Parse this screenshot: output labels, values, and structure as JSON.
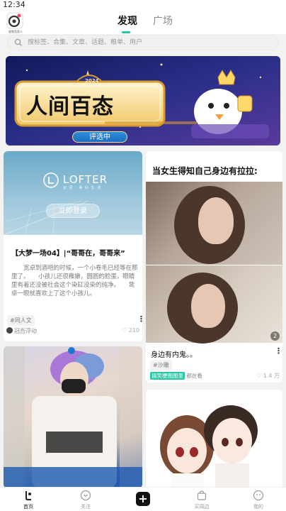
{
  "status": {
    "time": "12:34"
  },
  "header": {
    "logo_caption": "放牧吾家人",
    "tabs": [
      {
        "label": "发现",
        "active": true
      },
      {
        "label": "广场",
        "active": false
      }
    ]
  },
  "search": {
    "placeholder": "搜标签、合集、文章、话题、粮单、用户"
  },
  "banner": {
    "title": "人间百态",
    "year": "2024",
    "button": "评选中"
  },
  "feed": {
    "left": [
      {
        "brand": "LOFTER",
        "brand_tagline": "记 录 · 美 好 生 活",
        "login_button": "立即登录",
        "title": "【大梦一场04】|“哥哥在，哥哥来”",
        "body": "　　宽卓到酒吧的时候，一个小卷毛已经等在那里了。　　小孩儿还很稚嫩，圆圆的脸蛋，眼睛里有着还没被社会这个染缸没染的纯净。　　鸷卓一眼就喜欢上了这个小孩儿。",
        "tag": "#同人文",
        "author": "冠吾浮动",
        "likes": "210"
      },
      {
        "image": "photo-post"
      }
    ],
    "right": [
      {
        "caption": "当女生得知自己身边有拉拉:",
        "page_count": "2",
        "title": "身边有内鬼。。",
        "tag": "#沙雕",
        "source_link": "搞笑梗图图里",
        "source_suffix": "都在看",
        "likes": "1.4 万"
      },
      {
        "image": "couple-illustration"
      }
    ]
  },
  "tabbar": {
    "items": [
      {
        "label": "首页",
        "icon": "home-icon",
        "active": true
      },
      {
        "label": "关注",
        "icon": "follow-icon",
        "active": false
      },
      {
        "label": "",
        "icon": "plus-icon",
        "active": false
      },
      {
        "label": "买周边",
        "icon": "shop-icon",
        "active": false
      },
      {
        "label": "我的",
        "icon": "profile-icon",
        "active": false
      }
    ]
  },
  "colors": {
    "accent": "#26c6a6",
    "banner_bg": "#1c2570"
  }
}
